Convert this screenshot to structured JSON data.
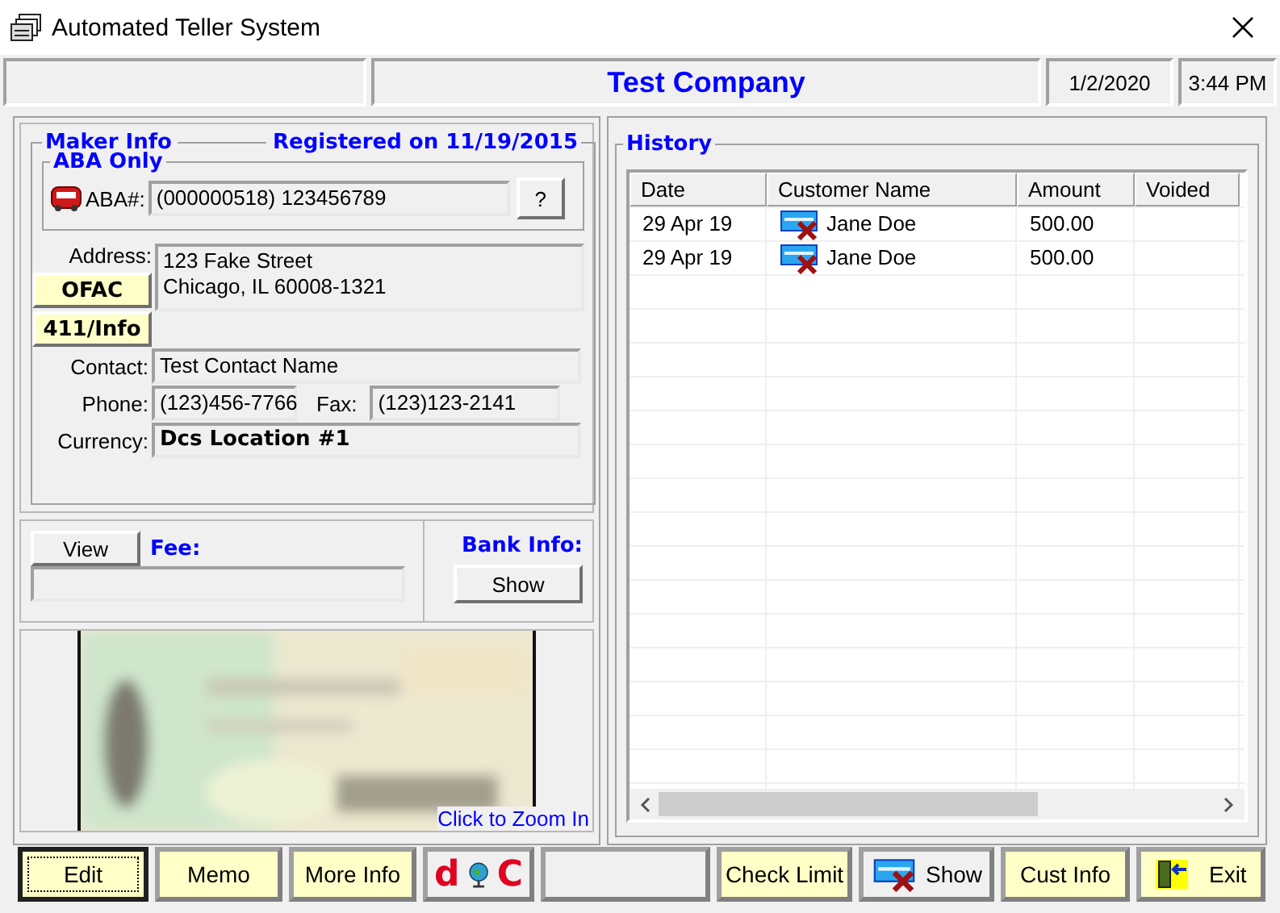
{
  "window": {
    "title": "Automated Teller System"
  },
  "header": {
    "company": "Test Company",
    "date": "1/2/2020",
    "time": "3:44 PM"
  },
  "maker_info": {
    "title": "Maker Info",
    "registered": "Registered on 11/19/2015",
    "aba_group": "ABA Only",
    "aba_label": "ABA#:",
    "aba_value": "(000000518) 123456789",
    "aba_help": "?",
    "address_label": "Address:",
    "address_lines": [
      "123  Fake Street",
      "Chicago, IL 60008-1321"
    ],
    "ofac": "OFAC",
    "info_button": "411/Info",
    "contact_label": "Contact:",
    "contact": "Test Contact Name",
    "phone_label": "Phone:",
    "phone": "(123)456-7766",
    "fax_label": "Fax:",
    "fax": "(123)123-2141",
    "currency_label": "Currency:",
    "currency": "Dcs Location #1"
  },
  "fee": {
    "view_button": "View",
    "label": "Fee:",
    "bank_label": "Bank Info:",
    "show_button": "Show"
  },
  "check_image": {
    "kind": "picture",
    "zoom_link": "Click to Zoom In"
  },
  "history": {
    "title": "History",
    "columns": [
      "Date",
      "Customer Name",
      "Amount",
      "Voided"
    ],
    "rows": [
      {
        "date": "29 Apr 19",
        "customer": "Jane Doe",
        "amount": "500.00"
      },
      {
        "date": "29 Apr 19",
        "customer": "Jane Doe",
        "amount": "500.00"
      }
    ]
  },
  "toolbar": {
    "buttons": [
      {
        "kind": "text",
        "label": "Edit",
        "focused": true
      },
      {
        "kind": "text",
        "label": "Memo",
        "focused": false
      },
      {
        "kind": "text",
        "label": "More Info",
        "focused": false
      },
      {
        "kind": "logo",
        "left": "d",
        "right": "C",
        "focused": false
      },
      {
        "kind": "blank"
      },
      {
        "kind": "text",
        "label": "Check Limit",
        "focused": false
      },
      {
        "kind": "icon",
        "label": "Show",
        "focused": false
      },
      {
        "kind": "text",
        "label": "Cust Info",
        "focused": false
      },
      {
        "kind": "exit",
        "label": "Exit",
        "focused": false
      }
    ]
  }
}
